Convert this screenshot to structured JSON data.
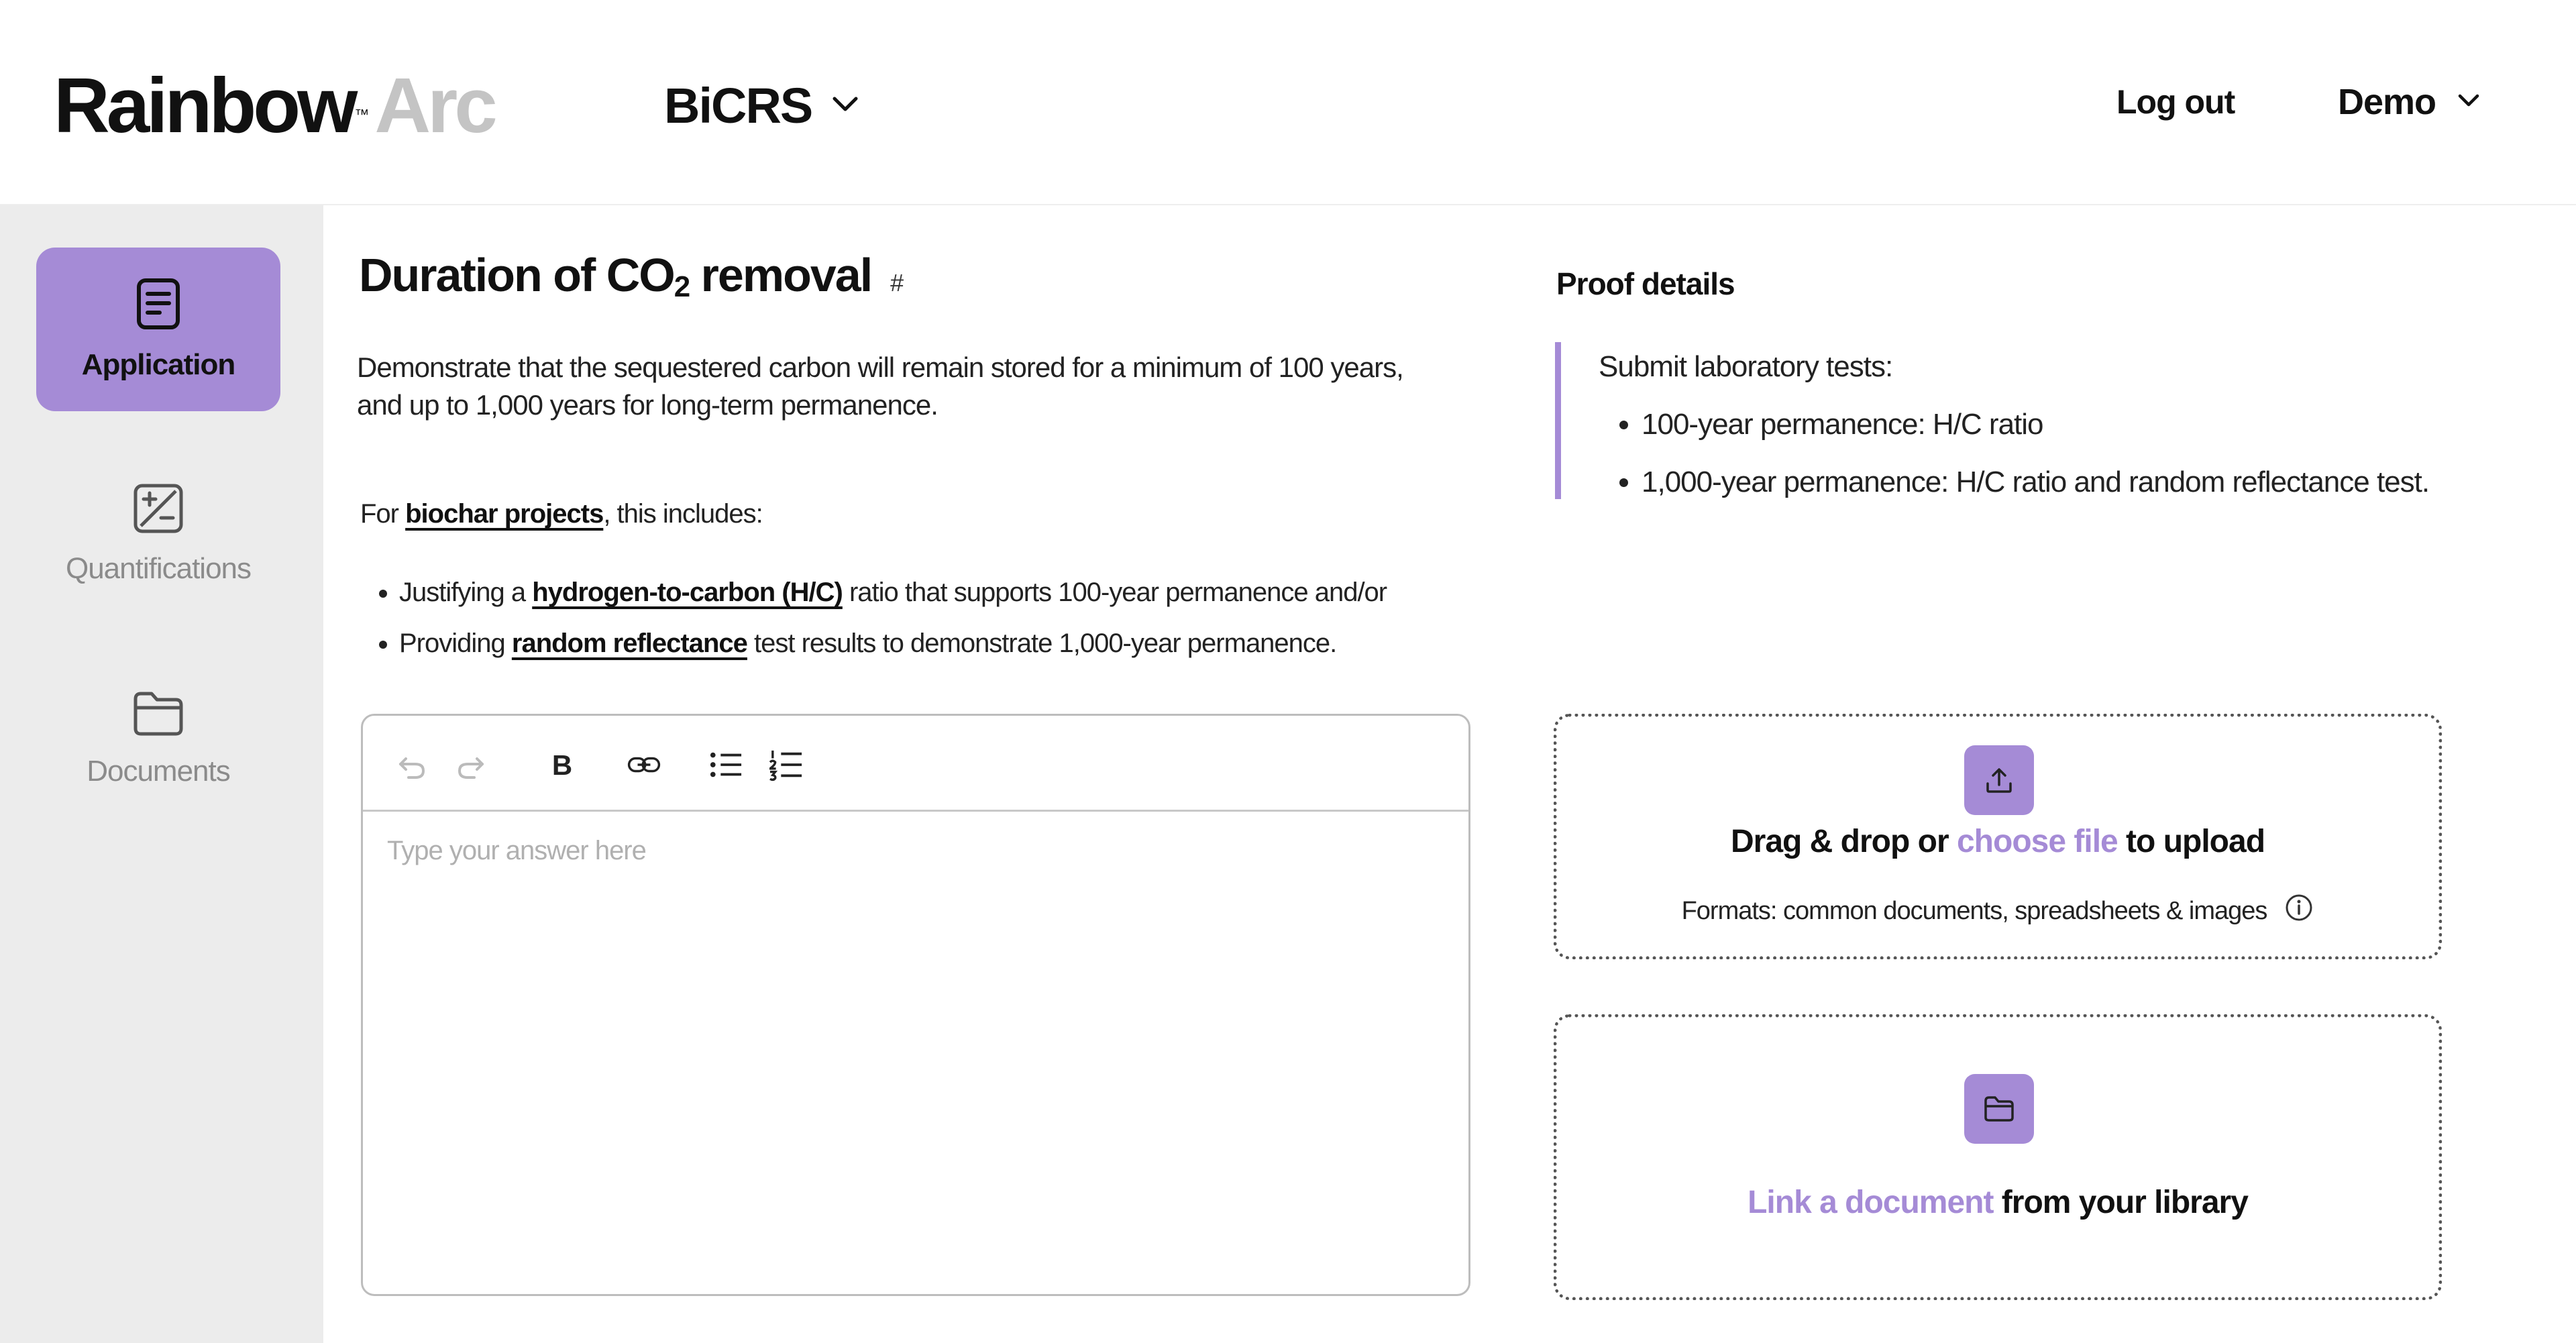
{
  "header": {
    "logo_primary": "Rainbow",
    "logo_tm": "™",
    "logo_secondary": "Arc",
    "project_selector": "BiCRS",
    "logout_label": "Log out",
    "user_label": "Demo"
  },
  "sidebar": {
    "items": [
      {
        "label": "Application",
        "icon": "document-icon",
        "active": true
      },
      {
        "label": "Quantifications",
        "icon": "calculator-icon",
        "active": false
      },
      {
        "label": "Documents",
        "icon": "folder-icon",
        "active": false
      }
    ]
  },
  "main": {
    "title_prefix": "Duration of CO",
    "title_subscript": "2",
    "title_suffix": " removal",
    "title_hash": "#",
    "description_line1": "Demonstrate that the sequestered carbon will remain stored for a minimum of 100 years,",
    "description_line2": "and up to 1,000 years for long-term  permanence.",
    "intro_prefix": "For ",
    "intro_link": "biochar projects",
    "intro_suffix": ", this includes:",
    "bullets": [
      {
        "prefix": "Justifying a ",
        "link": "hydrogen-to-carbon (H/C)",
        "suffix": " ratio that supports 100-year permanence and/or"
      },
      {
        "prefix": "Providing ",
        "link": "random reflectance",
        "suffix": " test results to demonstrate 1,000-year permanence."
      }
    ]
  },
  "editor": {
    "placeholder": "Type your answer here",
    "value": "",
    "toolbar": [
      "undo-icon",
      "redo-icon",
      "bold-icon",
      "link-icon",
      "bullet-list-icon",
      "numbered-list-icon"
    ]
  },
  "proof": {
    "title": "Proof details",
    "intro": "Submit laboratory tests:",
    "items": [
      "100-year permanence: H/C ratio",
      "1,000-year permanence: H/C ratio and random reflectance test."
    ]
  },
  "upload": {
    "text_prefix": "Drag & drop or ",
    "link": "choose file",
    "text_suffix": " to upload",
    "formats": "Formats: common documents, spreadsheets & images"
  },
  "library": {
    "link": "Link a document",
    "text_suffix": " from your library"
  },
  "colors": {
    "accent": "#a58bd6",
    "sidebar_bg": "#ececec",
    "logo_secondary": "#c4c4c4"
  }
}
